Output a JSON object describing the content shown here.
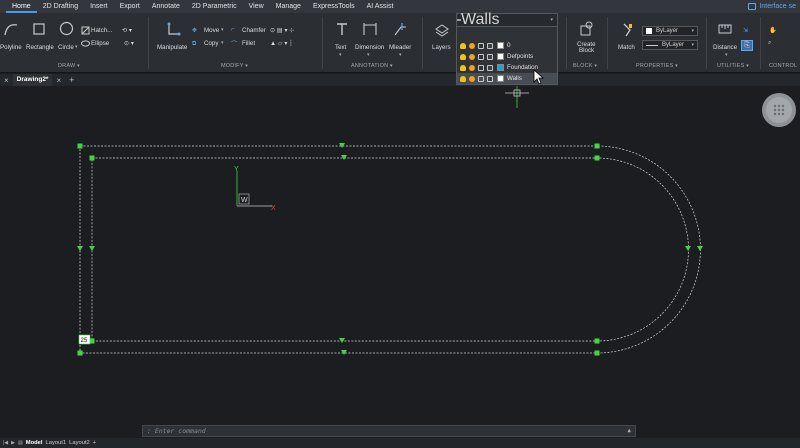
{
  "menu": {
    "items": [
      "Home",
      "2D Drafting",
      "Insert",
      "Export",
      "Annotate",
      "2D Parametric",
      "View",
      "Manage",
      "ExpressTools",
      "AI Assist"
    ],
    "active": "Home",
    "interface_link": "Interface se"
  },
  "ribbon": {
    "draw": {
      "title": "DRAW",
      "polyline": "Polyline",
      "rectangle": "Rectangle",
      "circle": "Circle",
      "hatch": "Hatch...",
      "ellipse": "Ellipse"
    },
    "modify": {
      "title": "MODIFY",
      "manipulate": "Manipulate",
      "move": "Move",
      "copy": "Copy",
      "chamfer": "Chamfer",
      "fillet": "Fillet"
    },
    "annotation": {
      "title": "ANNOTATION",
      "text": "Text",
      "dimension": "Dimension",
      "mleader": "Mleader"
    },
    "layers": {
      "label": "Layers"
    },
    "block": {
      "title": "BLOCK",
      "create_line1": "Create",
      "create_line2": "Block"
    },
    "properties": {
      "title": "PROPERTIES",
      "match": "Match",
      "color": "ByLayer",
      "linetype": "ByLayer"
    },
    "utilities": {
      "title": "UTILITIES",
      "distance": "Distance"
    },
    "control": {
      "title": "CONTROL"
    }
  },
  "layer_dropdown": {
    "current": "Walls",
    "items": [
      {
        "name": "0",
        "color": "#ffffff"
      },
      {
        "name": "Defpoints",
        "color": "#ffffff"
      },
      {
        "name": "Foundation",
        "color": "#1fa0d8"
      },
      {
        "name": "Walls",
        "color": "#ffffff"
      }
    ],
    "highlighted": "Walls"
  },
  "tabs": {
    "document": "Drawing2*"
  },
  "drawing": {
    "ucs_x": "X",
    "ucs_y": "Y",
    "ucs_w": "W",
    "dimension_readout": "25",
    "wall_color": "#d8d8d8",
    "grip_color": "#3fd63f"
  },
  "command": {
    "placeholder": ": Enter command"
  },
  "status": {
    "model": "Model",
    "layout1": "Layout1",
    "layout2": "Layout2"
  }
}
